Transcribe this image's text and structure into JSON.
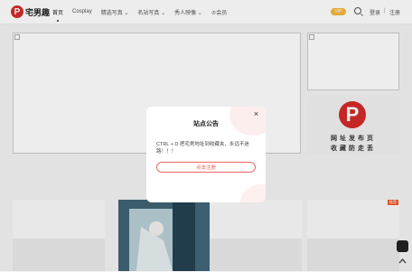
{
  "header": {
    "logo_letter": "P",
    "logo_text": "宅男趣",
    "nav": [
      "首页",
      "Cosplay",
      "精选写真 ⌄",
      "名站写真 ⌄",
      "秀人映像 ⌄",
      "会员"
    ],
    "vip_label": "VIP",
    "login_label": "登录",
    "separator": "|",
    "register_label": "注册"
  },
  "promo": {
    "letter": "P",
    "line1": "网址发布页",
    "line2": "收藏防走丢"
  },
  "cards": {
    "badge": "推荐"
  },
  "modal": {
    "title": "站点公告",
    "close_label": "×",
    "text": "CTRL + D 把宅男地址到收藏夹，永远不迷路！！！",
    "button_label": "点击注册"
  },
  "colors": {
    "brand": "#d42b2b",
    "vip": "#f6b73c",
    "badge": "#f25a2b"
  },
  "icons": [
    "search-icon",
    "close-icon",
    "crown-icon",
    "chat-icon",
    "top-icon"
  ]
}
